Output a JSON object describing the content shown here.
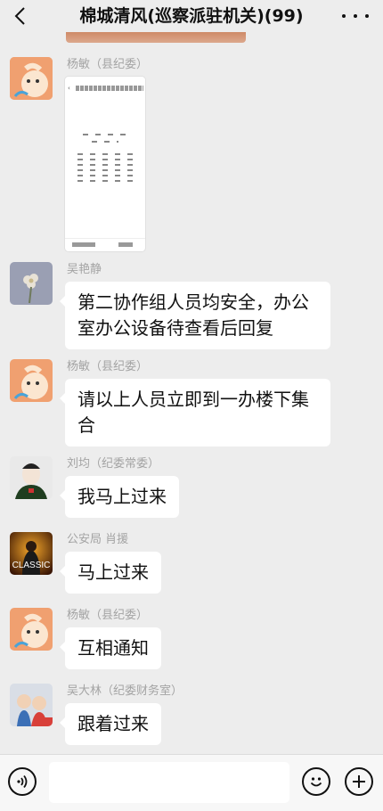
{
  "header": {
    "title": "棉城清风(巡察派驻机关)(99)",
    "back_icon": "chevron-left-icon",
    "more_icon": "ellipsis-icon"
  },
  "messages": [
    {
      "sender": "杨敏（县纪委）",
      "type": "image",
      "avatar": "cartoon-baby-avatar"
    },
    {
      "sender": "吴艳静",
      "text": "第二协作组人员均安全，办公室办公设备待查看后回复",
      "avatar": "flower-avatar"
    },
    {
      "sender": "杨敏（县纪委）",
      "text": "请以上人员立即到一办楼下集合",
      "avatar": "cartoon-baby-avatar"
    },
    {
      "sender": "刘均（纪委常委）",
      "text": "我马上过来",
      "avatar": "man-portrait-avatar"
    },
    {
      "sender": "公安局 肖援",
      "text": "马上过来",
      "avatar": "classic-movie-avatar",
      "avatar_caption": "CLASSIC"
    },
    {
      "sender": "杨敏（县纪委）",
      "text": "互相通知",
      "avatar": "cartoon-baby-avatar"
    },
    {
      "sender": "吴大林（纪委财务室）",
      "text": "跟着过来",
      "avatar": "kids-photo-avatar"
    }
  ],
  "input_bar": {
    "voice_icon": "voice-icon",
    "emoji_icon": "emoji-icon",
    "plus_icon": "plus-icon",
    "message_value": ""
  },
  "colors": {
    "background": "#ededed",
    "bubble": "#ffffff",
    "sender_name": "#a4a4a4"
  }
}
